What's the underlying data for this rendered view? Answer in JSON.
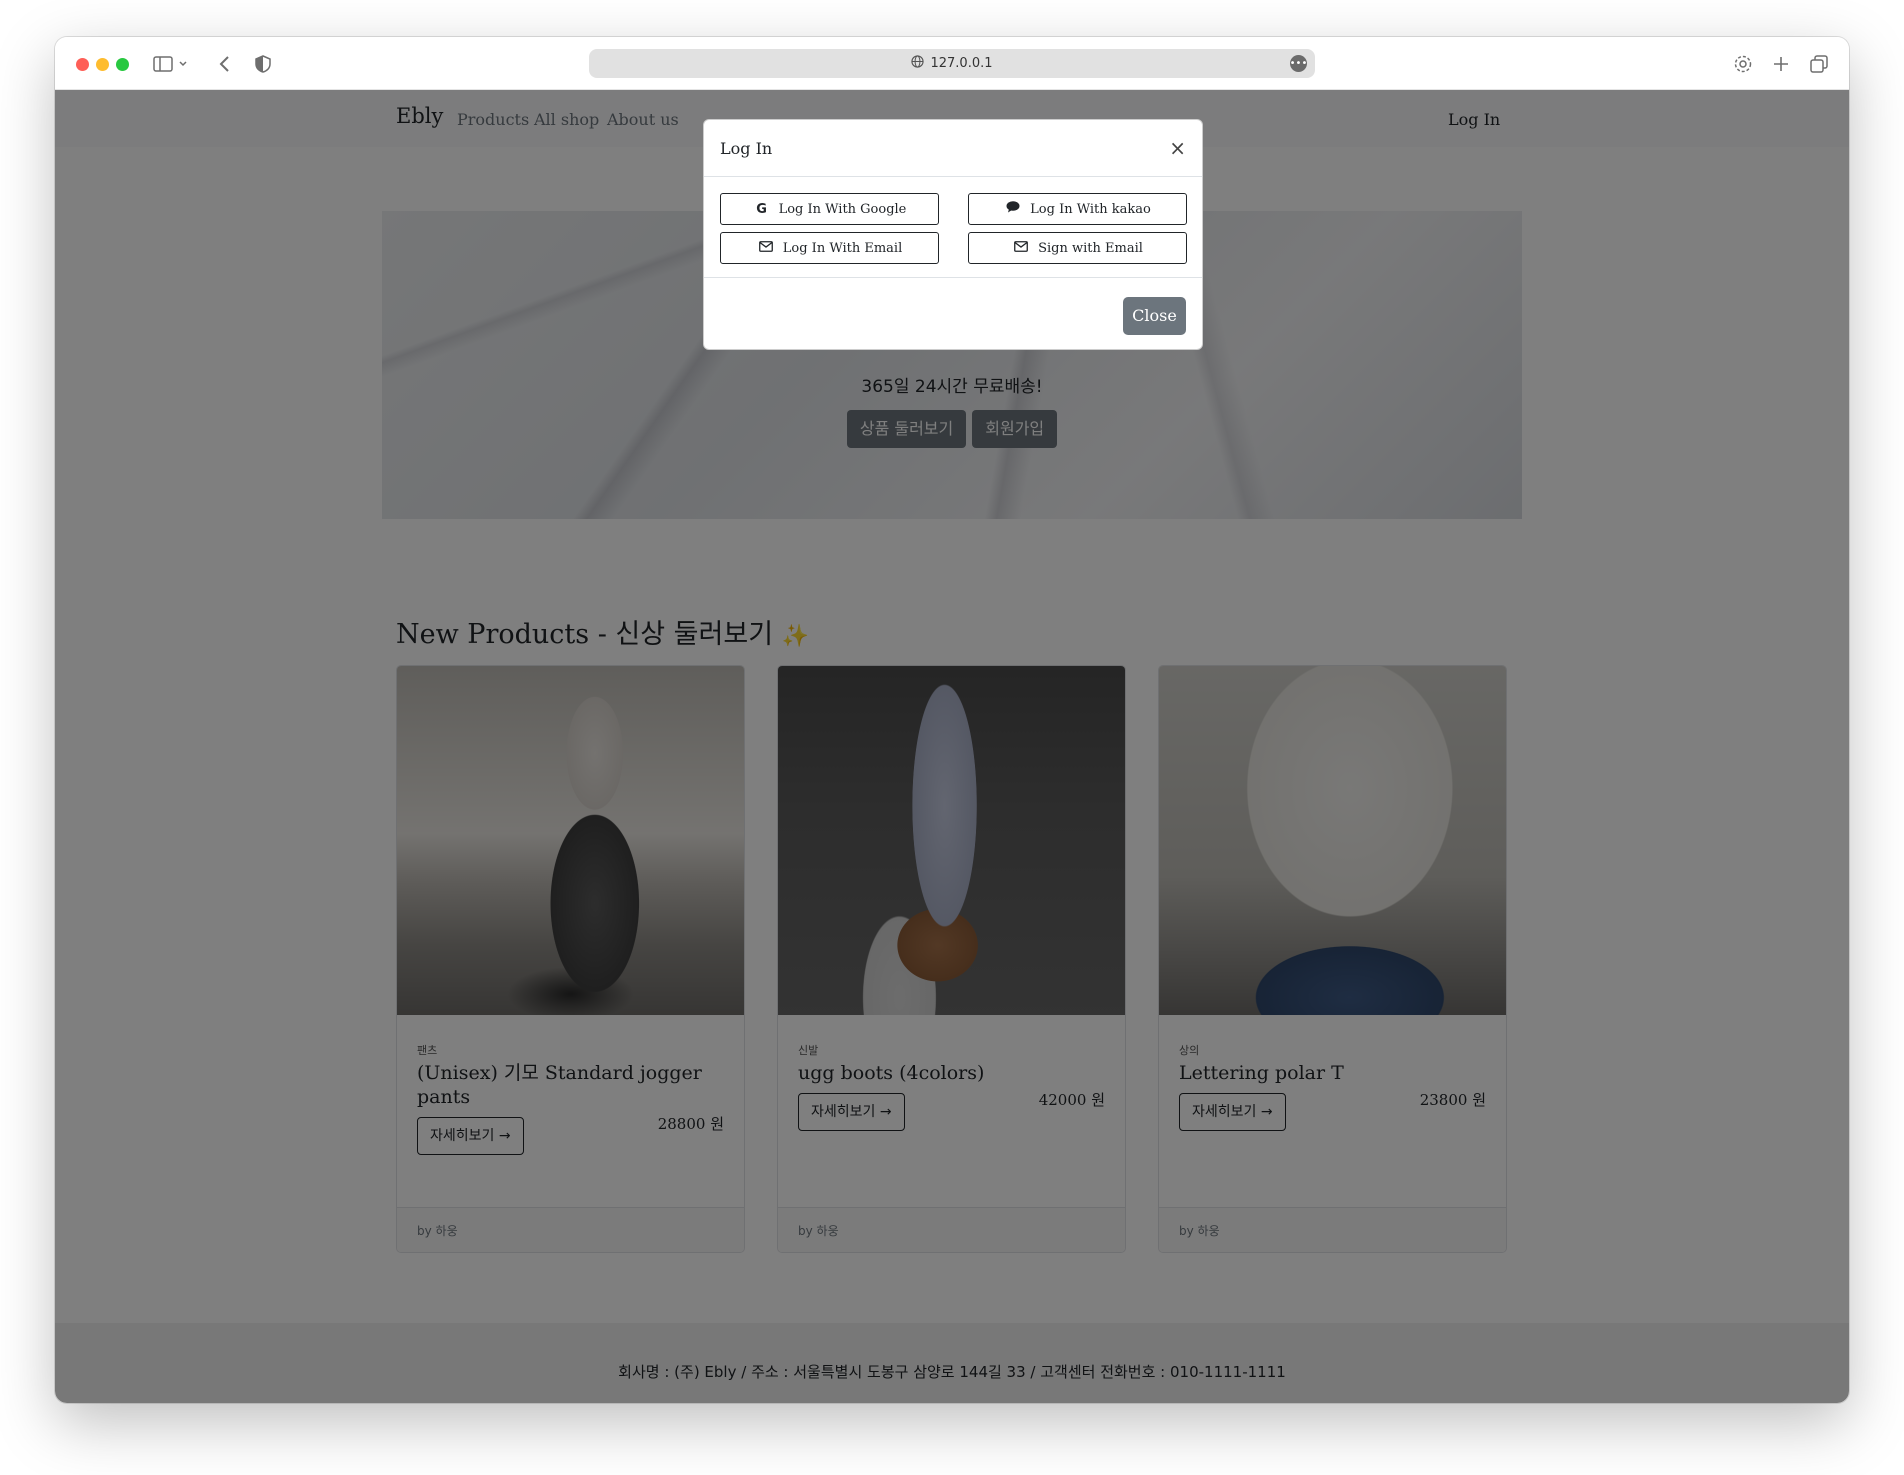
{
  "browser": {
    "url": "127.0.0.1"
  },
  "site": {
    "brand": "Ebly",
    "nav": [
      "Products",
      "All shop",
      "About us"
    ],
    "login": "Log In"
  },
  "hero": {
    "subtitle": "365일 24시간 무료배송!",
    "buttons": [
      "상품 둘러보기",
      "회원가입"
    ]
  },
  "section": {
    "title": "New Products - 신상 둘러보기",
    "emoji": "✨"
  },
  "products": [
    {
      "category": "팬츠",
      "name": "(Unisex) 기모 Standard jogger pants",
      "price": "28800 원",
      "detail": "자세히보기 →",
      "by": "by 하웅"
    },
    {
      "category": "신발",
      "name": "ugg boots (4colors)",
      "price": "42000 원",
      "detail": "자세히보기 →",
      "by": "by 하웅"
    },
    {
      "category": "상의",
      "name": "Lettering polar T",
      "price": "23800 원",
      "detail": "자세히보기 →",
      "by": "by 하웅"
    }
  ],
  "footer": {
    "text": "회사명 : (주) Ebly / 주소 : 서울특별시 도봉구 삼양로 144길 33 / 고객센터 전화번호 : 010-1111-1111"
  },
  "modal": {
    "title": "Log In",
    "close_x": "×",
    "buttons": [
      {
        "label": "Log In With Google",
        "icon": "G"
      },
      {
        "label": "Log In With kakao",
        "icon": "💬"
      },
      {
        "label": "Log In With Email",
        "icon": "✉"
      },
      {
        "label": "Sign with Email",
        "icon": "✉"
      }
    ],
    "close_label": "Close"
  },
  "colors": {
    "navbar": "#f8f9fa",
    "button_secondary": "#6c757d",
    "backdrop": "rgba(0,0,0,0.5)"
  }
}
